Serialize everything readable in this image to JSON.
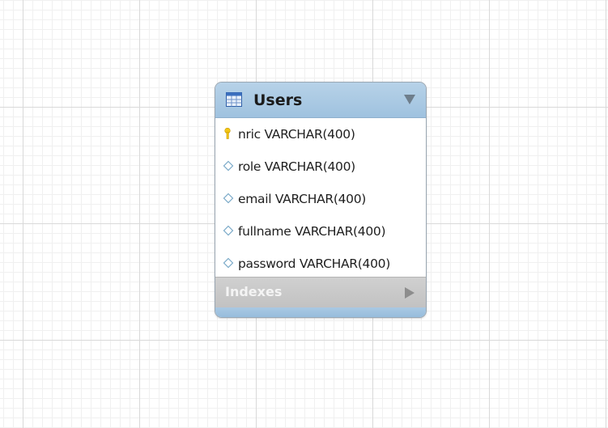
{
  "table": {
    "name": "Users",
    "columns": [
      {
        "text": "nric VARCHAR(400)",
        "key": "primary"
      },
      {
        "text": "role VARCHAR(400)",
        "key": "none"
      },
      {
        "text": "email VARCHAR(400)",
        "key": "none"
      },
      {
        "text": "fullname VARCHAR(400)",
        "key": "none"
      },
      {
        "text": "password VARCHAR(400)",
        "key": "none"
      }
    ],
    "indexes_label": "Indexes"
  },
  "icons": {
    "table": "table-icon",
    "collapse": "triangle-down-icon",
    "primary_key": "key-icon",
    "column": "diamond-icon",
    "expand": "triangle-right-icon"
  },
  "colors": {
    "header": "#a8c8e2",
    "indexes": "#c6c6c6",
    "key": "#f0c000",
    "diamond": "#7aa9c8"
  }
}
